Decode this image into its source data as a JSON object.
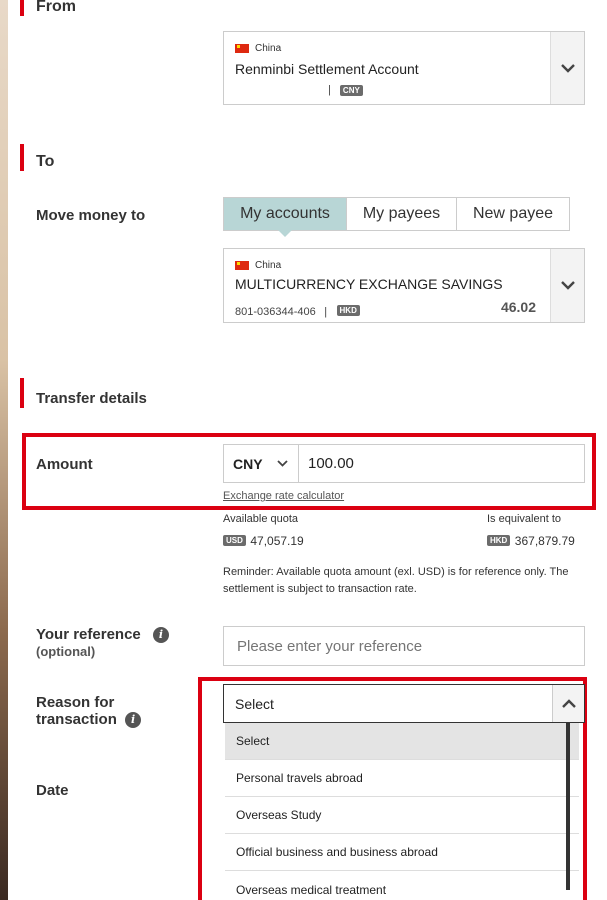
{
  "sections": {
    "from": "From",
    "to": "To",
    "transfer_details": "Transfer details"
  },
  "from_account": {
    "country": "China",
    "name": "Renminbi Settlement Account",
    "separator": "|",
    "currency": "CNY"
  },
  "to": {
    "label": "Move money to",
    "tabs": [
      {
        "label": "My accounts",
        "active": true
      },
      {
        "label": "My payees",
        "active": false
      },
      {
        "label": "New payee",
        "active": false
      }
    ],
    "account": {
      "country": "China",
      "name": "MULTICURRENCY EXCHANGE SAVINGS",
      "number": "801-036344-406",
      "separator": "|",
      "currency": "HKD",
      "balance": "46.02"
    }
  },
  "amount": {
    "label": "Amount",
    "currency": "CNY",
    "value": "100.00",
    "calculator_link": "Exchange rate calculator",
    "available_quota_label": "Available quota",
    "available_quota_currency": "USD",
    "available_quota_value": "47,057.19",
    "equivalent_label": "Is equivalent to",
    "equivalent_currency": "HKD",
    "equivalent_value": "367,879.79",
    "reminder": "Reminder: Available quota amount (exl. USD) is for reference only. The settlement is subject to transaction rate."
  },
  "reference": {
    "label": "Your reference",
    "sublabel": "(optional)",
    "placeholder": "Please enter your reference"
  },
  "reason": {
    "label_line1": "Reason for",
    "label_line2": "transaction",
    "selected": "Select",
    "options": [
      "Select",
      "Personal travels abroad",
      "Overseas Study",
      "Official business and business abroad",
      "Overseas medical treatment"
    ]
  },
  "date": {
    "label": "Date"
  },
  "colors": {
    "accent_red": "#db0011",
    "active_tab": "#b8d6d6",
    "badge_gray": "#6b6b6b"
  }
}
